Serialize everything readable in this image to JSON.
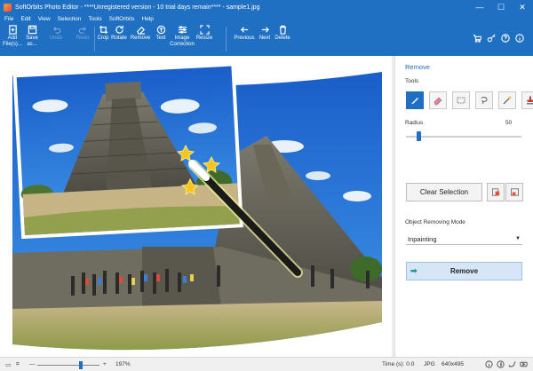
{
  "window": {
    "title": "SoftOrbits Photo Editor - ****Unregistered version - 10 trial days remain**** - sample1.jpg",
    "minimize": "—",
    "maximize": "☐",
    "close": "✕"
  },
  "menu": [
    "File",
    "Edit",
    "View",
    "Selection",
    "Tools",
    "SoftOrbits",
    "Help"
  ],
  "toolbar": {
    "add_files": "Add\nFile(s)...",
    "save_as": "Save\nas...",
    "undo": "Undo",
    "redo": "Redo",
    "crop": "Crop",
    "rotate": "Rotate",
    "remove": "Remove",
    "text": "Text",
    "image_correction": "Image\nCorrection",
    "resize": "Resize",
    "previous": "Previous",
    "next": "Next",
    "delete": "Delete"
  },
  "panel": {
    "title": "Remove",
    "tools_label": "Tools",
    "radius_label": "Radius",
    "radius_value": "50",
    "clear_selection": "Clear Selection",
    "mode_label": "Object Removing Mode",
    "mode_value": "Inpainting",
    "remove_button": "Remove"
  },
  "status": {
    "zoom_out": "—",
    "zoom_in": "+",
    "zoom": "197%",
    "time": "Time (s): 0.0",
    "format": "JPG",
    "size": "640x495"
  },
  "colors": {
    "accent": "#1f6fc2",
    "panel_title": "#1e6cc1",
    "remove_button_bg": "#d6e6f7"
  }
}
